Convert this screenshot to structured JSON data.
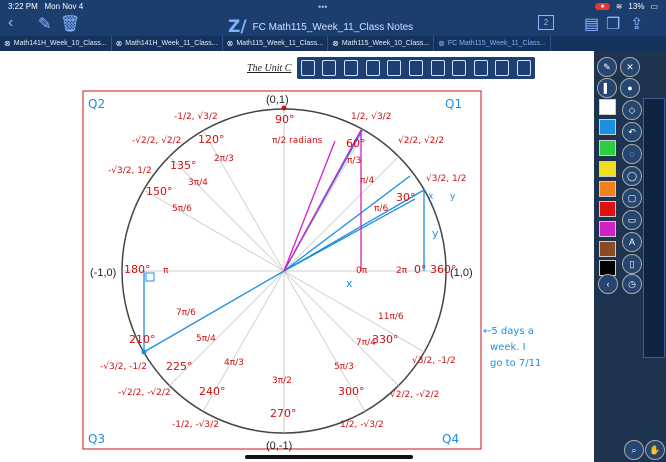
{
  "status": {
    "time": "3:22 PM",
    "date": "Mon Nov 4",
    "battery": "13%",
    "record": "●",
    "dots": "•••"
  },
  "header": {
    "title": "FC Math115_Week_11_Class Notes",
    "logo": "Z/",
    "pages_badge": "2"
  },
  "tabs": [
    {
      "label": "Math141H_Week_10_Class..."
    },
    {
      "label": "Math141H_Week_11_Class..."
    },
    {
      "label": "Math115_Week_11_Class..."
    },
    {
      "label": "Math115_Week_10_Class..."
    },
    {
      "label": "FC Math115_Week_11_Class..."
    }
  ],
  "page": {
    "heading": "The Unit C"
  },
  "colors": {
    "topbar": "#1b3e6f",
    "ink_red": "#d01010",
    "ink_blue": "#1d8fe0",
    "ink_magenta": "#d020c8"
  },
  "annotations": {
    "quadrants": [
      "Q2",
      "Q1",
      "Q3",
      "Q4"
    ],
    "points": [
      "(0,1)",
      "(-1,0)",
      "(1,0)",
      "(0,-1)"
    ],
    "angles": [
      "90°",
      "60°",
      "120°",
      "135°",
      "150°",
      "30°",
      "180°",
      "0°",
      "360°",
      "210°",
      "225°",
      "240°",
      "270°",
      "300°",
      "330°"
    ],
    "radians": [
      "π/2 radians",
      "π/3",
      "2π/3",
      "3π/4",
      "π/4",
      "5π/6",
      "π/6",
      "π",
      "0π",
      "2π",
      "7π/6",
      "5π/4",
      "4π/3",
      "3π/2",
      "5π/3",
      "7π/4",
      "11π/6"
    ],
    "coords": [
      "1/2, √3/2",
      "-1/2, √3/2",
      "-√2/2, √2/2",
      "√2/2, √2/2",
      "-√3/2, 1/2",
      "√3/2, 1/2",
      "-√3/2, -1/2",
      "-√2/2, -√2/2",
      "√3/2, -1/2",
      "√2/2, -√2/2",
      "-1/2, -√3/2",
      "1/2, -√3/2"
    ],
    "xy_labels": [
      "x",
      "y",
      "x",
      "y"
    ],
    "note_lines": [
      "←5 days a",
      "week. I",
      "go to 7/11"
    ]
  }
}
